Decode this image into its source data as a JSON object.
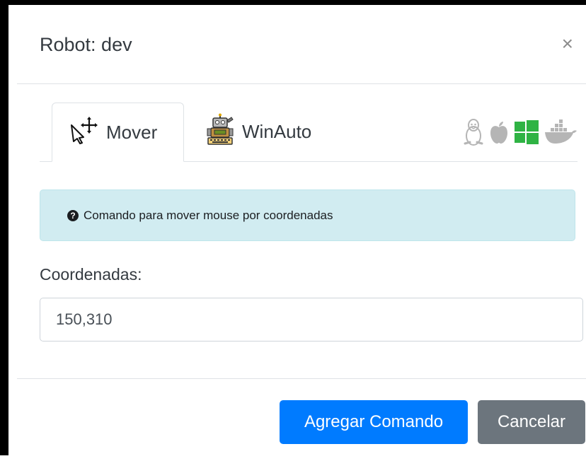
{
  "modal": {
    "title": "Robot: dev",
    "close_symbol": "×"
  },
  "tabs": [
    {
      "label": "Mover",
      "icon": "move-cursor-icon",
      "active": true
    },
    {
      "label": "WinAuto",
      "icon": "robot-icon",
      "active": false
    }
  ],
  "os_icons": [
    "linux-icon",
    "apple-icon",
    "windows-icon",
    "docker-icon"
  ],
  "colors": {
    "primary": "#007bff",
    "secondary": "#6c757d",
    "info_bg": "#d1ecf1",
    "windows_green": "#2fb344"
  },
  "alert": {
    "icon": "question-circle-icon",
    "text": "Comando para mover mouse por coordenadas"
  },
  "form": {
    "label": "Coordenadas:",
    "value": "150,310"
  },
  "footer": {
    "primary_label": "Agregar Comando",
    "secondary_label": "Cancelar"
  }
}
